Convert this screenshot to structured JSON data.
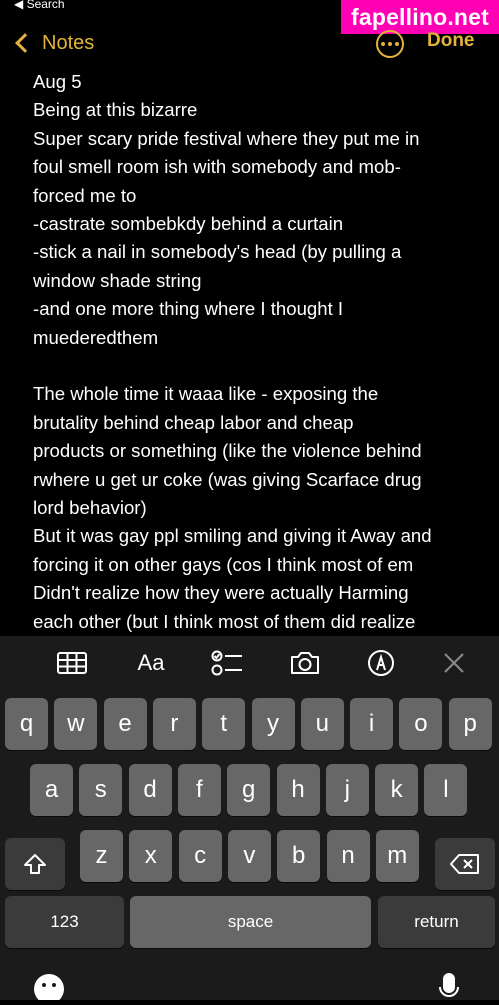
{
  "status_bar": {
    "back_label": "◀ Search"
  },
  "watermark": "fapellino.net",
  "nav": {
    "back_label": "Notes",
    "done_label": "Done"
  },
  "note": {
    "lines": [
      "Aug 5",
      "Being at this bizarre",
      "Super scary pride festival where they put me in",
      "foul smell room ish with somebody and mob-",
      "forced me to",
      "-castrate sombebkdy behind a curtain",
      "-stick a nail in somebody's head (by pulling a",
      "window shade string",
      "-and one more thing where I thought I",
      "muederedthem",
      "",
      "The whole time it waaa like - exposing the",
      "brutality behind cheap labor and cheap",
      "products  or something (like the violence behind",
      "rwhere u get ur coke (was giving Scarface drug",
      "lord behavior)",
      "But it was gay ppl smiling and giving it Away and",
      "forcing it on other gays (cos I think most of em",
      "Didn't realize how they were actually Harming",
      "each other (but I think most of them did realize"
    ]
  },
  "toolbar": {
    "format_label": "Aa",
    "icons": [
      "table-icon",
      "format-icon",
      "checklist-icon",
      "camera-icon",
      "markup-icon",
      "close-icon"
    ]
  },
  "keyboard": {
    "row1": [
      "q",
      "w",
      "e",
      "r",
      "t",
      "y",
      "u",
      "i",
      "o",
      "p"
    ],
    "row2": [
      "a",
      "s",
      "d",
      "f",
      "g",
      "h",
      "j",
      "k",
      "l"
    ],
    "row3": [
      "z",
      "x",
      "c",
      "v",
      "b",
      "n",
      "m"
    ],
    "numbers_label": "123",
    "space_label": "space",
    "return_label": "return"
  },
  "colors": {
    "accent": "#e3b33c",
    "watermark_bg": "#ff00b4",
    "key": "#676767",
    "key_dark": "#3b3b3b",
    "keyboard_bg": "#1b1b1b"
  }
}
